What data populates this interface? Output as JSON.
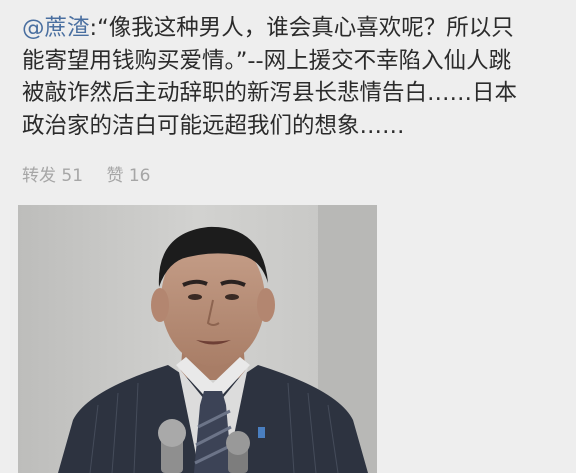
{
  "post": {
    "mention": "@蔗渣",
    "lines": [
      ":“像我这种男人，谁会真心喜欢呢？所以只",
      "能寄望用钱购买爱情。”--网上援交不幸陷入仙人跳",
      "被敲诈然后主动辞职的新泻县长悲情告白……日本",
      "政治家的洁白可能远超我们的想象……"
    ]
  },
  "stats": {
    "repost_label": "转发",
    "repost_count": "51",
    "like_label": "赞",
    "like_count": "16"
  },
  "photo": {
    "icon": "photo-man-in-suit-at-microphones"
  },
  "colors": {
    "background": "#eeeeee",
    "text": "#2b2b2b",
    "mention": "#4a6fa0",
    "stats": "#a6a6a6"
  }
}
